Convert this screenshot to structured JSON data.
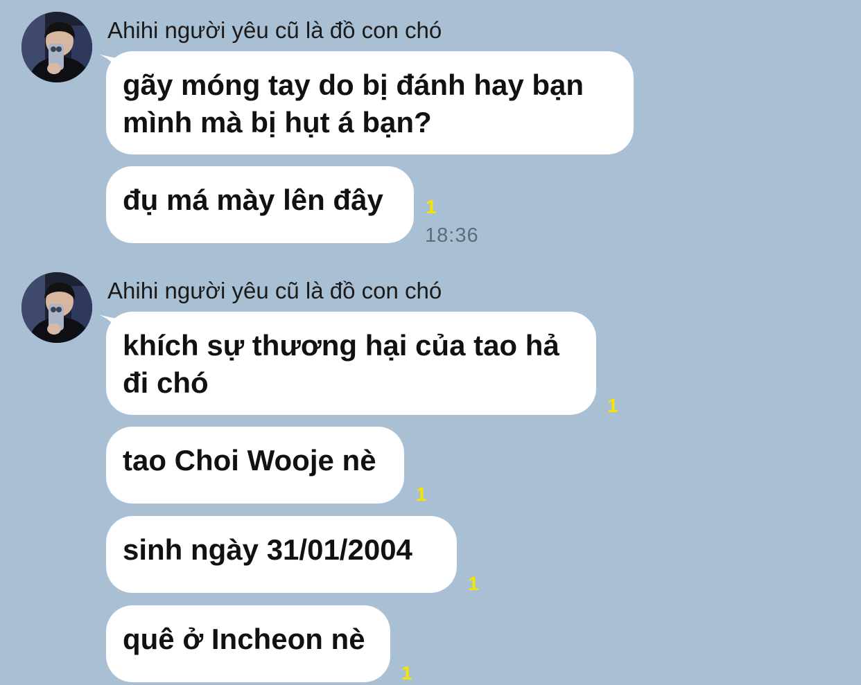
{
  "conversation": [
    {
      "sender": "Ahihi người yêu cũ là đồ con chó",
      "messages": [
        {
          "line1": "gãy móng tay do bị đánh hay bạn",
          "line2": "mình mà bị hụt á bạn?"
        },
        {
          "text": "đụ má mày lên đây",
          "unread": "1",
          "time": "18:36"
        }
      ]
    },
    {
      "sender": "Ahihi người yêu cũ là đồ con chó",
      "messages": [
        {
          "line1": "khích sự thương hại của tao hả",
          "line2": "đi chó",
          "unread": "1"
        },
        {
          "text": "tao Choi Wooje nè",
          "unread": "1"
        },
        {
          "text": "sinh ngày 31/01/2004",
          "unread": "1"
        },
        {
          "text": "quê ở Incheon nè",
          "unread": "1"
        }
      ]
    }
  ],
  "colors": {
    "background": "#a9bfd3",
    "bubble": "#ffffff",
    "unread": "#f6e300",
    "time": "#5f6b78"
  },
  "icons": {
    "avatar": "user-avatar-photo"
  }
}
